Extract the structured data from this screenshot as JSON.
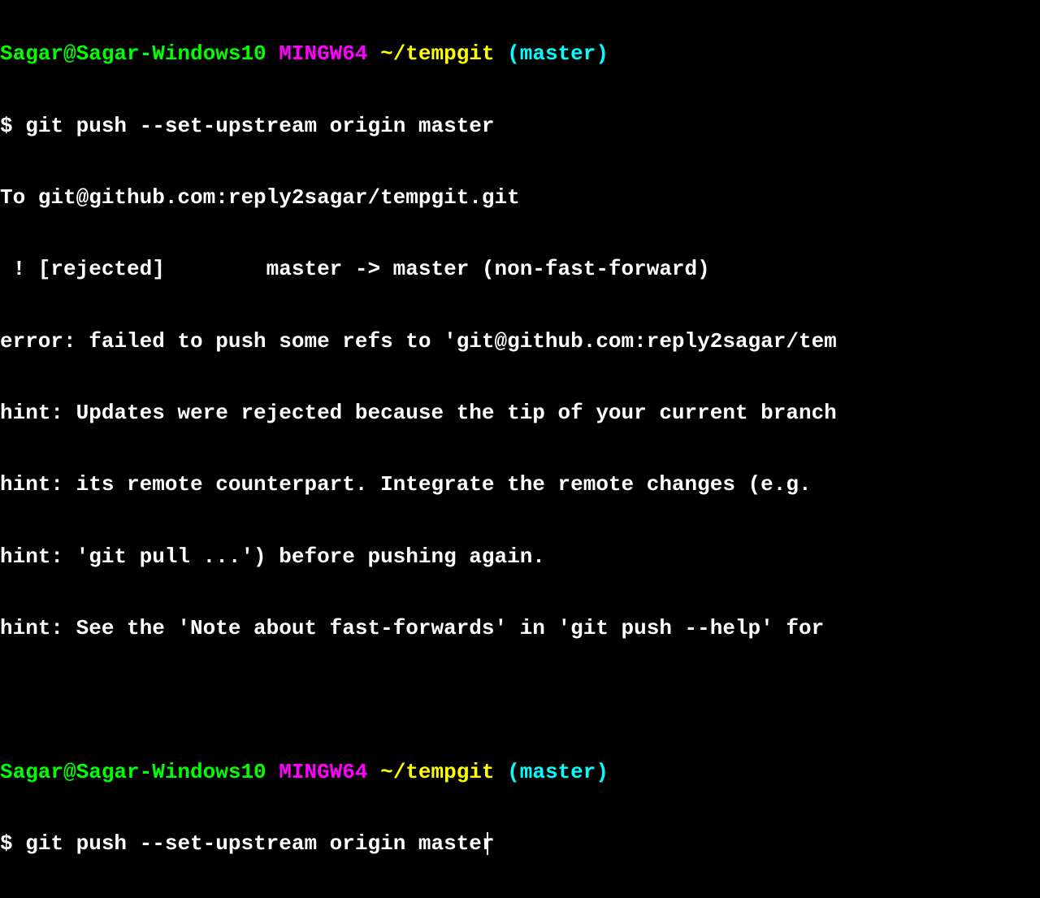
{
  "prompt1": {
    "user_host": "Sagar@Sagar-Windows10",
    "mingw": "MINGW64",
    "path": "~/tempgit",
    "branch": "(master)"
  },
  "command1": {
    "prefix": "$ ",
    "text": "git push --set-upstream origin master"
  },
  "output": {
    "line1": "To git@github.com:reply2sagar/tempgit.git",
    "line2": " ! [rejected]        master -> master (non-fast-forward)",
    "line3": "error: failed to push some refs to 'git@github.com:reply2sagar/tem",
    "line4": "hint: Updates were rejected because the tip of your current branch",
    "line5": "hint: its remote counterpart. Integrate the remote changes (e.g.",
    "line6": "hint: 'git pull ...') before pushing again.",
    "line7": "hint: See the 'Note about fast-forwards' in 'git push --help' for"
  },
  "prompt2": {
    "user_host": "Sagar@Sagar-Windows10",
    "mingw": "MINGW64",
    "path": "~/tempgit",
    "branch": "(master)"
  },
  "command2": {
    "prefix": "$ ",
    "text": "git push --set-upstream origin master"
  }
}
